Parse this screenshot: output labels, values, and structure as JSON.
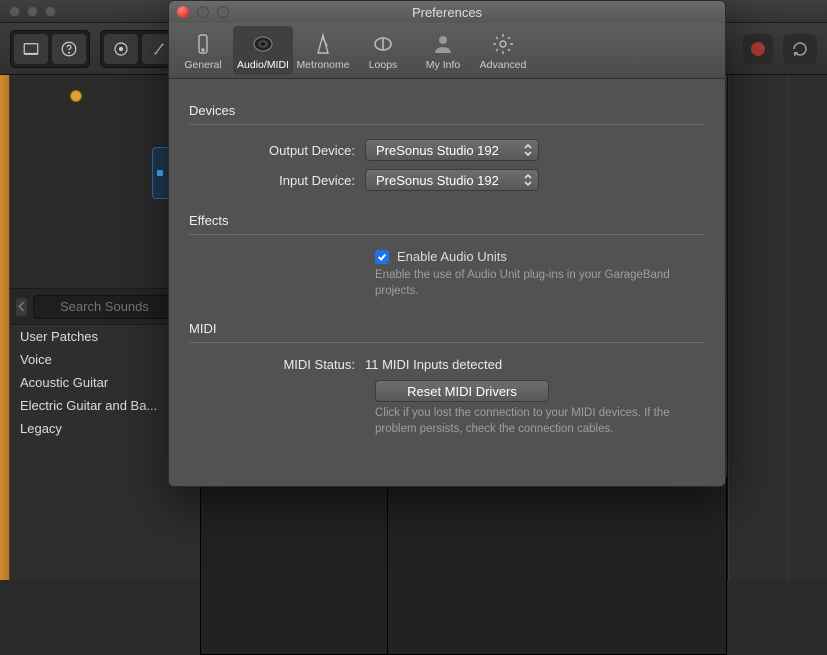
{
  "main": {
    "search_placeholder": "Search Sounds",
    "sounds": [
      "User Patches",
      "Voice",
      "Acoustic Guitar",
      "Electric Guitar and Ba...",
      "Legacy"
    ]
  },
  "prefs": {
    "title": "Preferences",
    "tabs": [
      "General",
      "Audio/MIDI",
      "Metronome",
      "Loops",
      "My Info",
      "Advanced"
    ],
    "selected_tab": 1,
    "devices": {
      "heading": "Devices",
      "output_label": "Output Device:",
      "output_value": "PreSonus Studio 192",
      "input_label": "Input Device:",
      "input_value": "PreSonus Studio 192"
    },
    "effects": {
      "heading": "Effects",
      "checkbox_label": "Enable Audio Units",
      "checkbox_checked": true,
      "hint": "Enable the use of Audio Unit plug-ins in your GarageBand projects."
    },
    "midi": {
      "heading": "MIDI",
      "status_label": "MIDI Status:",
      "status_value": "11 MIDI Inputs detected",
      "reset_label": "Reset MIDI Drivers",
      "reset_hint": "Click if you lost the connection to your MIDI devices. If the problem persists, check the connection cables."
    }
  }
}
